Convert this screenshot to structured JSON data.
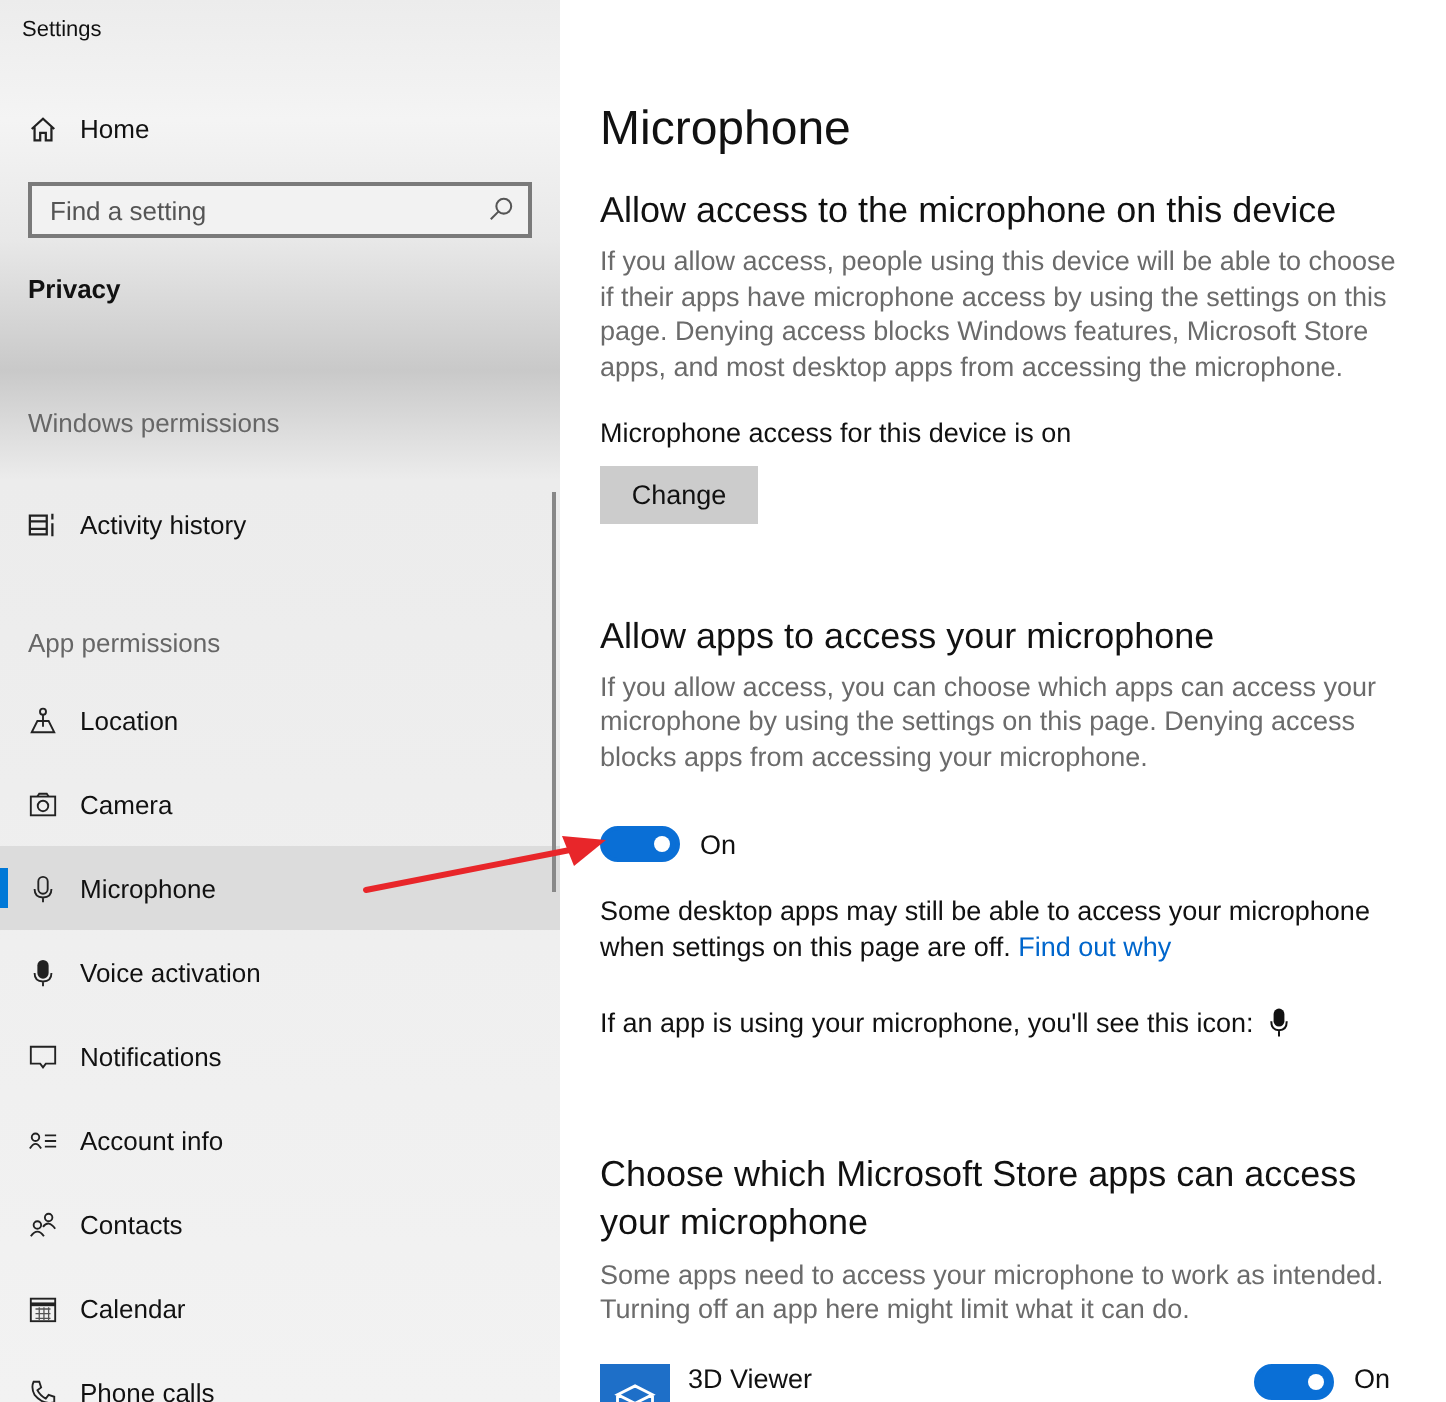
{
  "window": {
    "title": "Settings"
  },
  "sidebar": {
    "home": "Home",
    "search": {
      "placeholder": "Find a setting"
    },
    "category": "Privacy",
    "groups": [
      {
        "heading": "Windows permissions",
        "items": [
          {
            "label": "Activity history",
            "selected": false
          }
        ]
      },
      {
        "heading": "App permissions",
        "items": [
          {
            "label": "Location",
            "selected": false
          },
          {
            "label": "Camera",
            "selected": false
          },
          {
            "label": "Microphone",
            "selected": true
          },
          {
            "label": "Voice activation",
            "selected": false
          },
          {
            "label": "Notifications",
            "selected": false
          },
          {
            "label": "Account info",
            "selected": false
          },
          {
            "label": "Contacts",
            "selected": false
          },
          {
            "label": "Calendar",
            "selected": false
          },
          {
            "label": "Phone calls",
            "selected": false
          }
        ]
      }
    ]
  },
  "page": {
    "title": "Microphone",
    "device_section": {
      "heading": "Allow access to the microphone on this device",
      "description": "If you allow access, people using this device will be able to choose if their apps have microphone access by using the settings on this page. Denying access blocks Windows features, Microsoft Store apps, and most desktop apps from accessing the microphone.",
      "status": "Microphone access for this device is on",
      "button": "Change"
    },
    "apps_section": {
      "heading": "Allow apps to access your microphone",
      "description": "If you allow access, you can choose which apps can access your microphone by using the settings on this page. Denying access blocks apps from accessing your microphone.",
      "toggle": {
        "on": true,
        "label": "On"
      },
      "note": "Some desktop apps may still be able to access your microphone when settings on this page are off.",
      "link": "Find out why",
      "icon_note": "If an app is using your microphone, you'll see this icon:"
    },
    "store_section": {
      "heading": "Choose which Microsoft Store apps can access your microphone",
      "description": "Some apps need to access your microphone to work as intended. Turning off an app here might limit what it can do.",
      "apps": [
        {
          "name": "3D Viewer",
          "on": true,
          "label": "On"
        }
      ]
    }
  }
}
